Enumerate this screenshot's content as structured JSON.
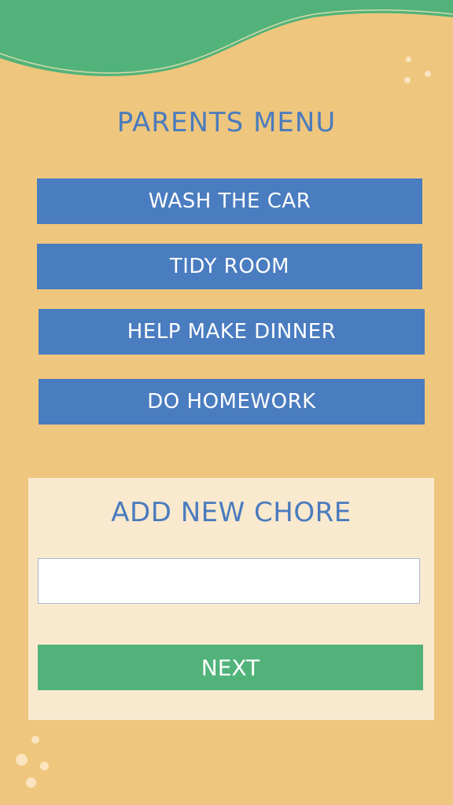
{
  "header": {
    "title": "PARENTS MENU"
  },
  "chores": [
    {
      "label": "WASH THE CAR"
    },
    {
      "label": "TIDY ROOM"
    },
    {
      "label": "HELP MAKE DINNER"
    },
    {
      "label": "DO HOMEWORK"
    }
  ],
  "add_chore": {
    "title": "ADD NEW CHORE",
    "input_value": "",
    "input_placeholder": "",
    "next_label": "NEXT"
  },
  "colors": {
    "background": "#efc67d",
    "wave_green": "#52b37a",
    "button_blue": "#4a7cc0",
    "text_blue": "#4a7bbd",
    "panel": "#f9e9cf",
    "next_green": "#52b37a"
  }
}
